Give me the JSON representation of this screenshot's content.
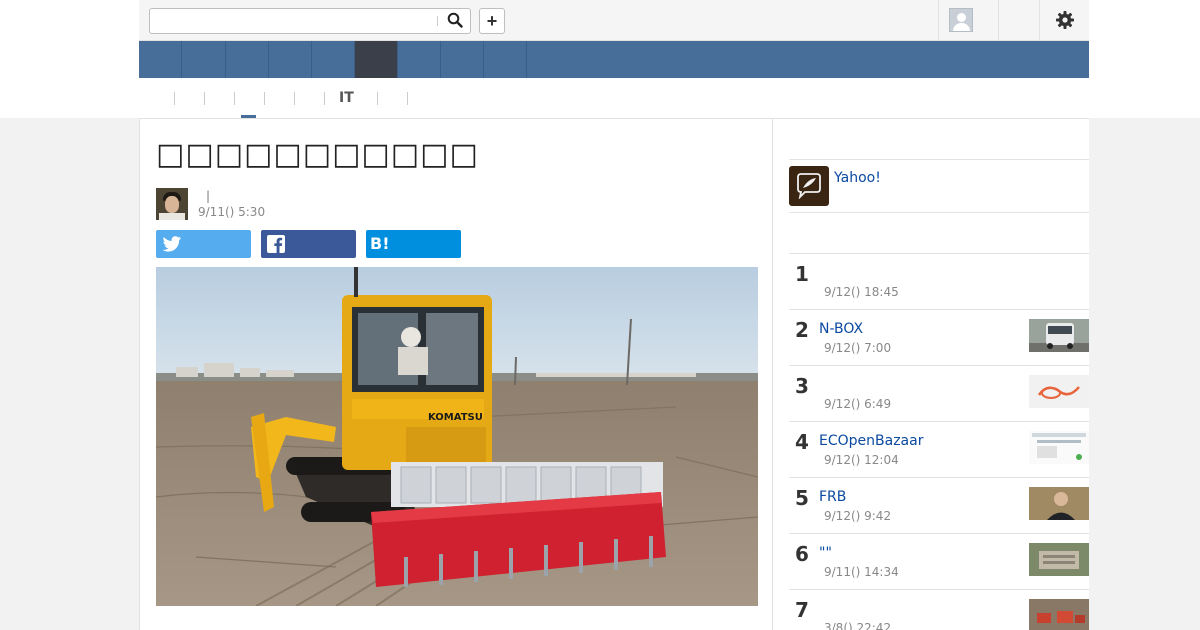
{
  "search": {
    "value": "",
    "placeholder": ""
  },
  "header": {
    "plus_label": "+"
  },
  "nav": {
    "tabs": [
      {
        "label": ""
      },
      {
        "label": ""
      },
      {
        "label": ""
      },
      {
        "label": ""
      },
      {
        "label": ""
      },
      {
        "label": "",
        "active": true
      },
      {
        "label": ""
      },
      {
        "label": ""
      },
      {
        "label": ""
      }
    ]
  },
  "subnav": {
    "it_label": "IT"
  },
  "article": {
    "title": "□□□□□□□□□□□",
    "author_separator": "|",
    "date": "9/11() 5:30",
    "photo_brand": "KOMATSU"
  },
  "sidebar": {
    "promo_label": "Yahoo!",
    "ranking": [
      {
        "rank": "1",
        "title": "",
        "date": "9/12() 18:45"
      },
      {
        "rank": "2",
        "title": "N-BOX",
        "date": "9/12() 7:00"
      },
      {
        "rank": "3",
        "title": "",
        "date": "9/12() 6:49"
      },
      {
        "rank": "4",
        "title": "ECOpenBazaar",
        "date": "9/12() 12:04"
      },
      {
        "rank": "5",
        "title": "FRB",
        "date": "9/12() 9:42"
      },
      {
        "rank": "6",
        "title": "\"\"",
        "date": "9/11() 14:34"
      },
      {
        "rank": "7",
        "title": "",
        "date": "3/8() 22:42"
      }
    ]
  },
  "colors": {
    "nav_bg": "#466e99",
    "nav_active": "#3b3f4a",
    "link": "#0b4aa0",
    "twitter": "#55acee",
    "facebook": "#3b5998",
    "hatena": "#008fde"
  }
}
